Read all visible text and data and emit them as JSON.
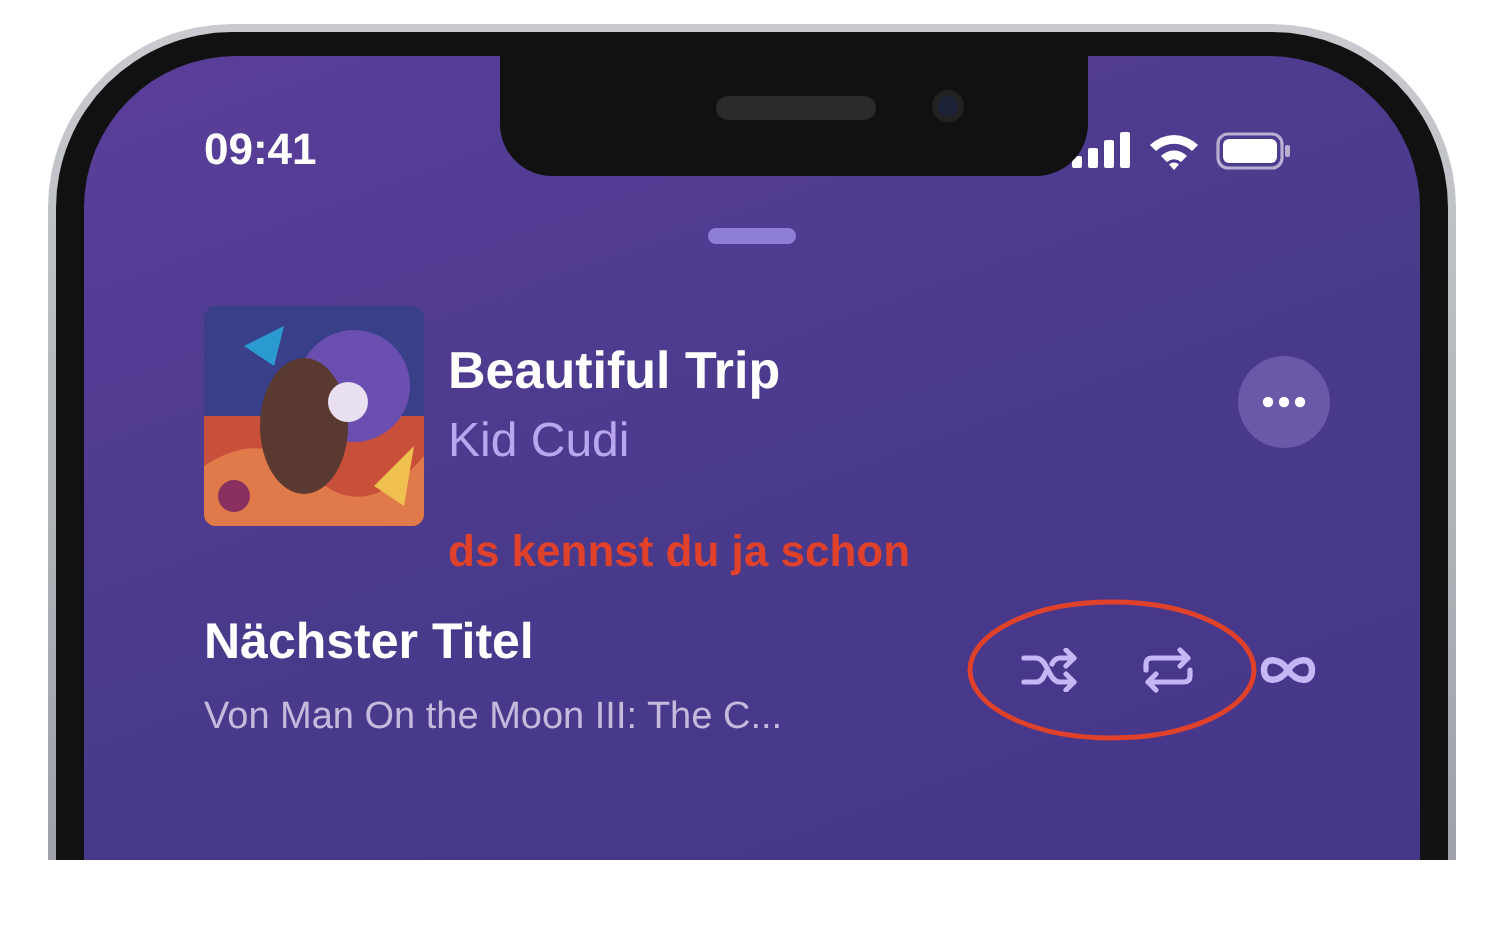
{
  "status_bar": {
    "time": "09:41"
  },
  "now_playing": {
    "title": "Beautiful Trip",
    "artist": "Kid Cudi"
  },
  "annotation": {
    "text": "ds kennst du ja schon"
  },
  "up_next": {
    "heading": "Nächster Titel",
    "subtitle": "Von Man On the Moon III: The C..."
  }
}
